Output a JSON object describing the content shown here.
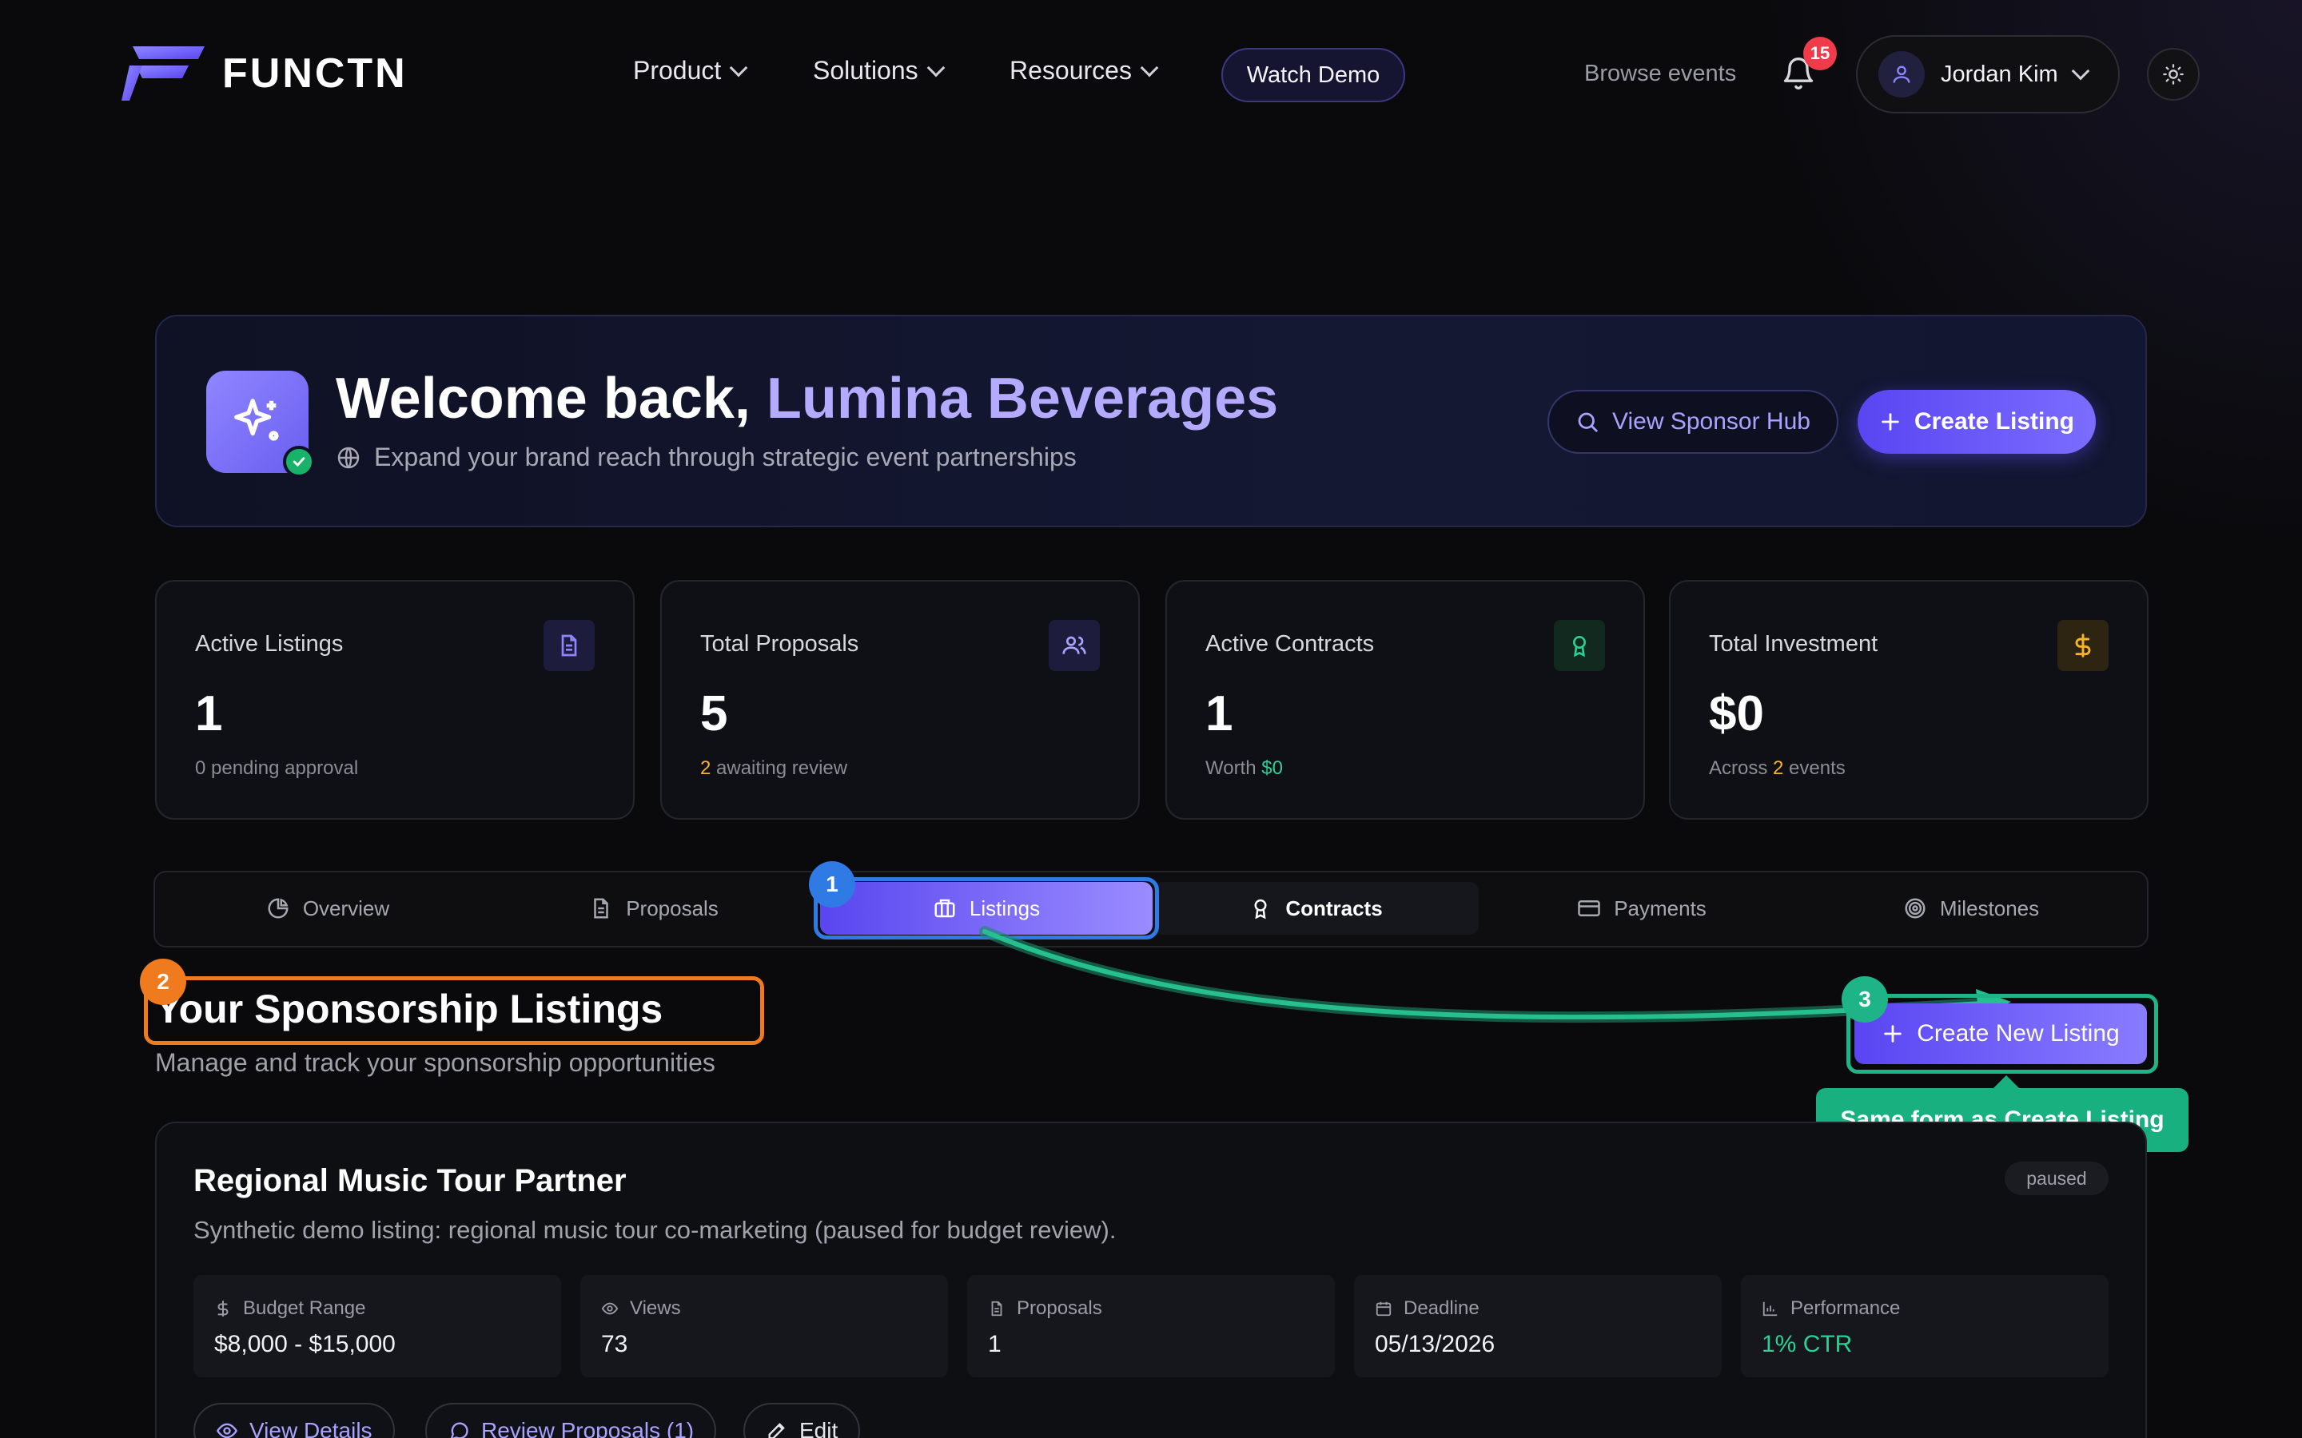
{
  "nav": {
    "logo_text": "FUNCTN",
    "items": [
      "Product",
      "Solutions",
      "Resources"
    ],
    "watch_demo": "Watch Demo",
    "browse_events": "Browse events",
    "notification_count": "15",
    "user_name": "Jordan Kim"
  },
  "welcome": {
    "title_prefix": "Welcome back, ",
    "brand": "Lumina Beverages",
    "subtitle": "Expand your brand reach through strategic event partnerships",
    "view_hub": "View Sponsor Hub",
    "create_listing": "Create Listing"
  },
  "stats": [
    {
      "label": "Active Listings",
      "value": "1",
      "note_highlight": "",
      "note": "0 pending approval",
      "icon": "document-icon"
    },
    {
      "label": "Total Proposals",
      "value": "5",
      "note_highlight": "2",
      "note": " awaiting review",
      "icon": "users-icon"
    },
    {
      "label": "Active Contracts",
      "value": "1",
      "note_prefix": "Worth ",
      "note_highlight": "$0",
      "icon": "award-icon"
    },
    {
      "label": "Total Investment",
      "value": "$0",
      "note_prefix": "Across ",
      "note_highlight": "2",
      "note": " events",
      "icon": "dollar-icon"
    }
  ],
  "tabs": [
    "Overview",
    "Proposals",
    "Listings",
    "Contracts",
    "Payments",
    "Milestones"
  ],
  "section": {
    "title": "Your Sponsorship Listings",
    "subtitle": "Manage and track your sponsorship opportunities",
    "create_new": "Create New Listing",
    "tooltip": "Same form as Create Listing"
  },
  "markers": [
    "1",
    "2",
    "3"
  ],
  "listing": {
    "title": "Regional Music Tour Partner",
    "status": "paused",
    "description": "Synthetic demo listing: regional music tour co-marketing (paused for budget review).",
    "metrics": [
      {
        "label": "Budget Range",
        "value": "$8,000 - $15,000",
        "icon": "dollar-icon"
      },
      {
        "label": "Views",
        "value": "73",
        "icon": "eye-icon"
      },
      {
        "label": "Proposals",
        "value": "1",
        "icon": "document-icon"
      },
      {
        "label": "Deadline",
        "value": "05/13/2026",
        "icon": "calendar-icon"
      },
      {
        "label": "Performance",
        "value": "1% CTR",
        "icon": "bar-chart-icon"
      }
    ],
    "actions": [
      "View Details",
      "Review Proposals (1)",
      "Edit"
    ]
  },
  "colors": {
    "accent": "#5a45f2",
    "brand_text": "#b4aaff",
    "marker_blue": "#2f7ae5",
    "marker_orange": "#f07a1e",
    "marker_green": "#1fb487",
    "badge_red": "#ef3b4a"
  }
}
